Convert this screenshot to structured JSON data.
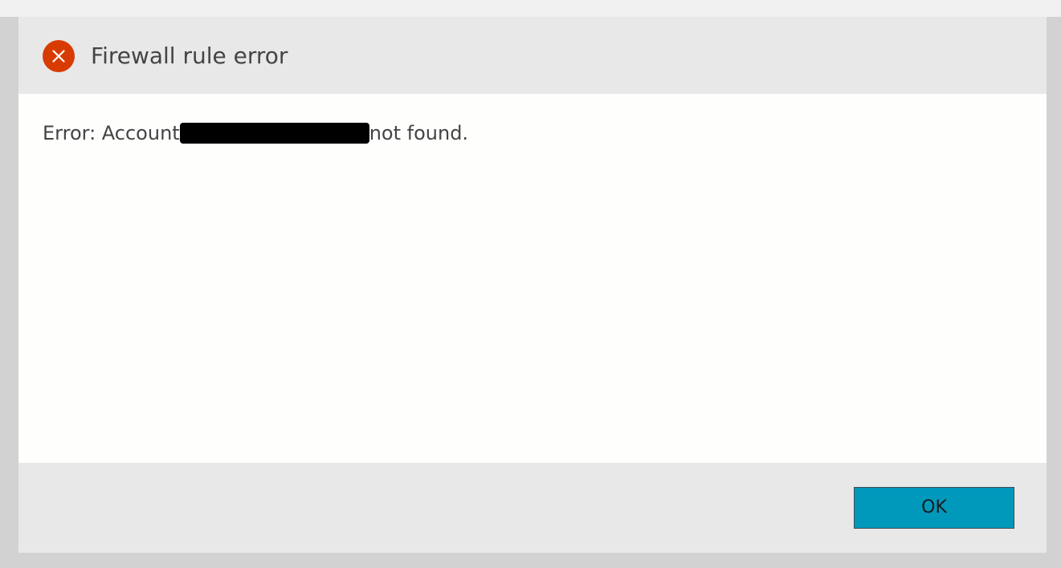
{
  "dialog": {
    "title": "Firewall rule error",
    "icon": "error-circle-x-icon",
    "icon_color": "#d83b01",
    "message_prefix": "Error: Account",
    "message_suffix": "not found.",
    "ok_label": "OK",
    "button_color": "#0099bc"
  }
}
